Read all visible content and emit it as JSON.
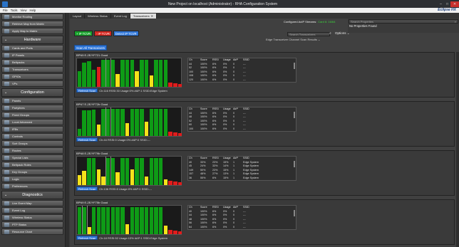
{
  "window": {
    "title": "New Project on localhost (Administrator) - RHA Configuration System",
    "logo": "Eclipse HX"
  },
  "menu": [
    "File",
    "Tools",
    "View",
    "Help"
  ],
  "sidebar": {
    "top": [
      {
        "label": "Monitor Routing",
        "icon": "monitor-icon"
      },
      {
        "label": "Retrieve Map from Matrix",
        "icon": "retrieve-icon"
      },
      {
        "label": "Apply Map to Matrix",
        "icon": "apply-icon"
      }
    ],
    "sections": [
      {
        "title": "Hardware",
        "items": [
          "Cards and Ports",
          "IP Panels",
          "Beltpacks",
          "Transceivers",
          "GPIOs",
          "VPs"
        ]
      },
      {
        "title": "Configuration",
        "items": [
          "Panels",
          "Partylines",
          "Fixed Groups",
          "Local Advanced",
          "IFBs",
          "Controls",
          "Sort Groups",
          "Routes",
          "Special Lists",
          "Beltpack Roles",
          "Key Groups",
          "Logic",
          "Preferences"
        ]
      },
      {
        "title": "Diagnostics",
        "items": [
          "Live Event Map",
          "Event Log",
          "Wireless Status",
          "PTP Status",
          "Resource Chart"
        ]
      }
    ]
  },
  "tabs": [
    {
      "label": "Layout",
      "active": false
    },
    {
      "label": "Wireless Status",
      "active": false
    },
    {
      "label": "Event Log",
      "active": false
    },
    {
      "label": "Transceivers",
      "active": true
    }
  ],
  "properties": {
    "search_placeholder": "Search Properties",
    "empty": "No Properties Found"
  },
  "toolbar": {
    "configured_label": "Configured AoIP Streams:",
    "configured_value": "Card 6: 16/64",
    "search_placeholder": "Search Transceivers",
    "options_label": "Options",
    "add_ip": "+ IP TCVR",
    "remove_ip": "- IP TCVR",
    "detect": "Detect IP TCVR",
    "scan_all": "Scan All Transceivers",
    "edge_header": "Edge Transceiver Channel Scan Results"
  },
  "table_headers": [
    "Ch",
    "Score",
    "RSSI",
    "Usage",
    "AirP",
    "SSID"
  ],
  "cards": [
    {
      "title": "BPN5 E-2E/YF721 Good",
      "scan_info": "Ch:116  RSSI:30  Usage:0%  #AP:1  SSID:Edge System",
      "rows": [
        [
          "44",
          "100%",
          "6%",
          "0%",
          "0",
          "---"
        ],
        [
          "52",
          "100%",
          "6%",
          "0%",
          "0",
          "---"
        ],
        [
          "100",
          "100%",
          "6%",
          "0%",
          "0",
          "---"
        ],
        [
          "108",
          "100%",
          "6%",
          "0%",
          "0",
          "---"
        ],
        [
          "120",
          "100%",
          "6%",
          "0%",
          "0",
          "---"
        ]
      ]
    },
    {
      "title": "BPN7 E-2E/YF72b Good",
      "scan_info": "Ch:44  RSSI:0  Usage:0%  #AP:0  SSID:---",
      "rows": [
        [
          "Ch",
          "Score",
          "RSSI",
          "Usage",
          "AirP",
          "SSID"
        ],
        [
          "44",
          "100%",
          "6%",
          "0%",
          "0",
          "---"
        ],
        [
          "48",
          "100%",
          "6%",
          "0%",
          "0",
          "---"
        ],
        [
          "52",
          "100%",
          "6%",
          "0%",
          "0",
          "---"
        ],
        [
          "60",
          "100%",
          "6%",
          "0%",
          "0",
          "---"
        ],
        [
          "100",
          "100%",
          "6%",
          "0%",
          "0",
          "---"
        ]
      ]
    },
    {
      "title": "BPN8 E-2E/YF79b Good",
      "scan_info": "Ch:136  RSSI:0  Usage:0%  #AP:0  SSID:---",
      "rows": [
        [
          "Ch",
          "Score",
          "RSSI",
          "Usage",
          "AirP",
          "SSID"
        ],
        [
          "40",
          "33%",
          "23%",
          "15%",
          "1",
          "Edge System"
        ],
        [
          "45",
          "24%",
          "33%",
          "14%",
          "1",
          "Edge System"
        ],
        [
          "149",
          "50%",
          "23%",
          "15%",
          "1",
          "Edge System"
        ],
        [
          "157",
          "48%",
          "27%",
          "13%",
          "1",
          "Edge System"
        ],
        [
          "36",
          "55%",
          "6%",
          "15%",
          "1",
          "Edge System"
        ]
      ]
    },
    {
      "title": "BPN9 E-2E/YF75b Good",
      "scan_info": "Ch:18  RSSI:52  Usage:13%  #AP:1  SSID:Edge System",
      "rows": [
        [
          "Ch",
          "Score",
          "RSSI",
          "Usage",
          "AirP",
          "SSID"
        ],
        [
          "40",
          "100%",
          "6%",
          "0%",
          "0",
          "---"
        ],
        [
          "44",
          "100%",
          "6%",
          "0%",
          "0",
          "---"
        ],
        [
          "48",
          "100%",
          "6%",
          "0%",
          "0",
          "---"
        ],
        [
          "56",
          "100%",
          "6%",
          "0%",
          "0",
          "---"
        ],
        [
          "64",
          "100%",
          "6%",
          "0%",
          "0",
          "---"
        ]
      ]
    }
  ],
  "colors": {
    "green": "#0e9b16",
    "yellow": "#f5e21a",
    "red": "#e11c1c",
    "accent": "#2f76d8"
  },
  "chart_levels": [
    [
      [
        "g",
        0.55
      ],
      [
        "g",
        0.85
      ],
      [
        "g",
        0.9
      ],
      [
        "g",
        0.6
      ],
      [
        "r",
        0.7
      ],
      [
        "g",
        0.95
      ],
      [
        "g",
        0.95
      ],
      [
        "g",
        0.95
      ],
      [
        "y",
        0.45
      ],
      [
        "g",
        0.95
      ],
      [
        "g",
        0.95
      ],
      [
        "g",
        0.95
      ],
      [
        "y",
        0.55
      ],
      [
        "g",
        0.95
      ],
      [
        "g",
        0.95
      ],
      [
        "y",
        0.4
      ],
      [
        "g",
        0.95
      ],
      [
        "g",
        0.95
      ],
      [
        "g",
        0.95
      ],
      [
        "r",
        0.15
      ],
      [
        "r",
        0.12
      ],
      [
        "r",
        0.1
      ]
    ],
    [
      [
        "g",
        0.25
      ],
      [
        "g",
        0.9
      ],
      [
        "g",
        0.9
      ],
      [
        "g",
        0.92
      ],
      [
        "y",
        0.4
      ],
      [
        "g",
        0.95
      ],
      [
        "g",
        0.95
      ],
      [
        "g",
        0.95
      ],
      [
        "g",
        0.95
      ],
      [
        "g",
        0.95
      ],
      [
        "y",
        0.45
      ],
      [
        "g",
        0.95
      ],
      [
        "g",
        0.95
      ],
      [
        "g",
        0.95
      ],
      [
        "y",
        0.5
      ],
      [
        "g",
        0.95
      ],
      [
        "g",
        0.95
      ],
      [
        "g",
        0.95
      ],
      [
        "g",
        0.95
      ],
      [
        "r",
        0.15
      ],
      [
        "r",
        0.12
      ],
      [
        "r",
        0.1
      ]
    ],
    [
      [
        "y",
        0.35
      ],
      [
        "y",
        0.5
      ],
      [
        "g",
        0.95
      ],
      [
        "g",
        0.95
      ],
      [
        "y",
        0.55
      ],
      [
        "y",
        0.3
      ],
      [
        "g",
        0.95
      ],
      [
        "g",
        0.95
      ],
      [
        "y",
        0.45
      ],
      [
        "g",
        0.95
      ],
      [
        "g",
        0.95
      ],
      [
        "y",
        0.55
      ],
      [
        "g",
        0.95
      ],
      [
        "g",
        0.95
      ],
      [
        "y",
        0.3
      ],
      [
        "g",
        0.95
      ],
      [
        "g",
        0.95
      ],
      [
        "g",
        0.95
      ],
      [
        "y",
        0.2
      ],
      [
        "r",
        0.15
      ],
      [
        "r",
        0.12
      ],
      [
        "r",
        0.1
      ]
    ],
    [
      [
        "g",
        0.95
      ],
      [
        "g",
        0.95
      ],
      [
        "y",
        0.25
      ],
      [
        "g",
        0.95
      ],
      [
        "g",
        0.95
      ],
      [
        "g",
        0.95
      ],
      [
        "g",
        0.95
      ],
      [
        "g",
        0.95
      ],
      [
        "g",
        0.95
      ],
      [
        "g",
        0.95
      ],
      [
        "y",
        0.35
      ],
      [
        "g",
        0.95
      ],
      [
        "g",
        0.95
      ],
      [
        "g",
        0.95
      ],
      [
        "g",
        0.95
      ],
      [
        "g",
        0.95
      ],
      [
        "g",
        0.95
      ],
      [
        "g",
        0.95
      ],
      [
        "y",
        0.3
      ],
      [
        "r",
        0.15
      ],
      [
        "r",
        0.12
      ],
      [
        "r",
        0.1
      ]
    ]
  ]
}
